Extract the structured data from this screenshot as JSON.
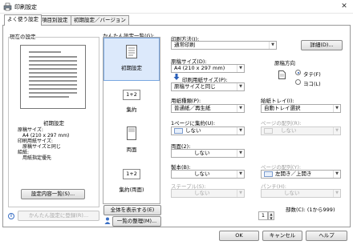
{
  "window": {
    "title": "印刷設定",
    "close_glyph": "✕"
  },
  "tabs": [
    {
      "label": "よく使う設定"
    },
    {
      "label": "項目別設定"
    },
    {
      "label": "初期設定／バージョン"
    }
  ],
  "current_settings": {
    "group_label": "現在の設定",
    "preset_name": "初期設定",
    "details": [
      "原稿サイズ:",
      "A4 (210 x 297 mm)",
      "印刷用紙サイズ:",
      "原稿サイズと同じ",
      "給紙:",
      "用紙指定優先"
    ],
    "details_button": "設定内容一覧(S)...",
    "register_button": "かんたん設定に登録(R)..."
  },
  "easy_settings": {
    "label": "かんたん設定一覧(G):",
    "items": [
      {
        "caption": "初期設定",
        "icon": "document-icon"
      },
      {
        "caption": "集約",
        "icon_text": "1+2"
      },
      {
        "caption": "両面",
        "icon": "duplex-icon"
      },
      {
        "caption": "集約(両面)",
        "icon_text": "1+2"
      }
    ],
    "show_all_button": "全体を表示する(E)",
    "organize_button": "一覧の整理(M)..."
  },
  "print_method": {
    "label": "印刷方法(J):",
    "value": "通常印刷",
    "details_button": "詳細(D)..."
  },
  "original_size": {
    "label": "原稿サイズ(D):",
    "value": "A4 (210 x 297 mm)"
  },
  "paper_size": {
    "label": "印刷用紙サイズ(P):",
    "value": "原稿サイズと同じ"
  },
  "orientation": {
    "label": "原稿方向",
    "options": [
      "タテ(F)",
      "ヨコ(L)"
    ],
    "selected": "タテ(F)"
  },
  "paper_type": {
    "label": "用紙種類(P):",
    "value": "普通紙／再生紙"
  },
  "paper_tray": {
    "label": "給紙トレイ(I):",
    "value": "自動トレイ選択"
  },
  "nup": {
    "label": "1ページに集約(U):",
    "value": "しない"
  },
  "page_order": {
    "label": "ページの配列(R):",
    "value": "しない"
  },
  "duplex": {
    "label": "両面(2):",
    "value": "しない"
  },
  "booklet": {
    "label": "製本(B):",
    "value": "しない"
  },
  "page_layout": {
    "label": "ページの配列(Y):",
    "value": "左開き／上開き"
  },
  "staple": {
    "label": "ステープル(S):",
    "value": "しない"
  },
  "punch": {
    "label": "パンチ(H):",
    "value": "しない"
  },
  "copies": {
    "label": "部数(C): (1から999)",
    "value": "1"
  },
  "footer": {
    "ok": "OK",
    "cancel": "キャンセル",
    "help": "ヘルプ"
  }
}
